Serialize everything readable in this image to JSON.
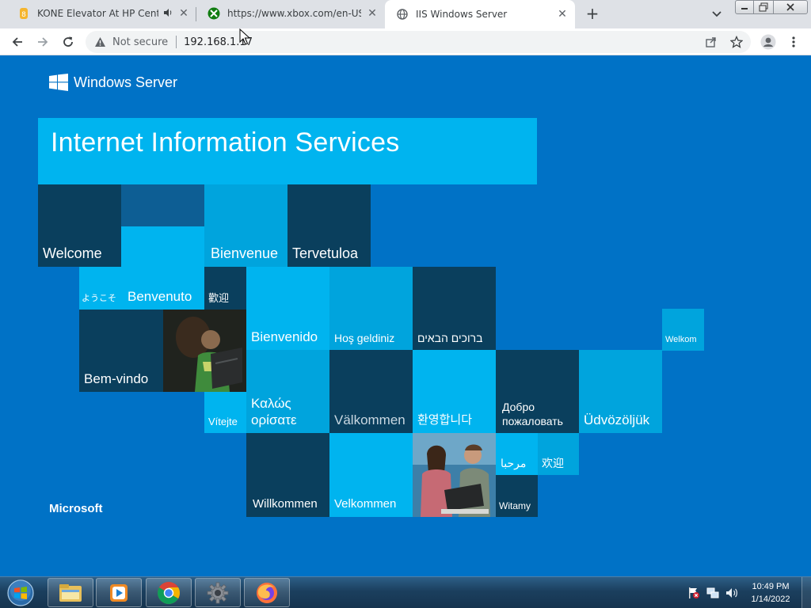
{
  "browser": {
    "tabs": [
      {
        "title": "KONE Elevator At HP Centre",
        "favicon": "kone-icon",
        "audio": true,
        "active": false
      },
      {
        "title": "https://www.xbox.com/en-US/we",
        "favicon": "xbox-icon",
        "audio": false,
        "active": false
      },
      {
        "title": "IIS Windows Server",
        "favicon": "globe-icon",
        "audio": false,
        "active": true
      }
    ],
    "new_tab_label": "+",
    "close_glyph": "✕",
    "audio_glyph": "🔊",
    "security_label": "Not secure",
    "url": "192.168.1.17"
  },
  "page": {
    "brand": "Windows Server",
    "banner_title": "Internet Information Services",
    "footer_brand": "Microsoft",
    "tiles": {
      "welcome": "Welcome",
      "youkoso": "ようこそ",
      "benvenuto": "Benvenuto",
      "bienvenue": "Bienvenue",
      "tervetuloa": "Tervetuloa",
      "kangei_tw": "歡迎",
      "bienvenido": "Bienvenido",
      "hos_geldiniz": "Hoş geldiniz",
      "hebrew": "ברוכים הבאים",
      "welkom": "Welkom",
      "bem_vindo": "Bem-vindo",
      "vitejte": "Vítejte",
      "kalos": "Καλώς ορίσατε",
      "valkommen": "Välkommen",
      "korean": "환영합니다",
      "dobro": "Добро пожаловать",
      "udvozoljuk": "Üdvözöljük",
      "arabic": "مرحبا",
      "huanying": "欢迎",
      "willkommen": "Willkommen",
      "velkommen": "Velkommen",
      "witamy": "Witamy"
    }
  },
  "taskbar": {
    "apps": [
      "explorer",
      "media-player",
      "chrome",
      "settings",
      "firefox"
    ],
    "time": "10:49 PM",
    "date": "1/14/2022"
  },
  "colors": {
    "page_bg": "#0072c6",
    "tile_dark": "#0a3f5d",
    "tile_light": "#00b4ef",
    "tile_mid": "#00a4dd"
  }
}
